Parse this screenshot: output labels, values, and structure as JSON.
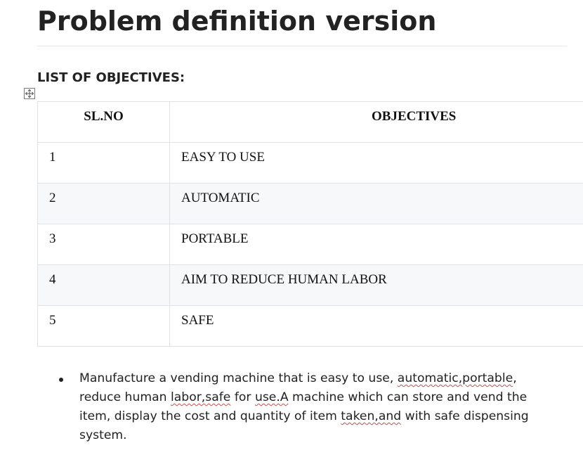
{
  "document": {
    "title": "Problem definition version",
    "section_heading": "LIST OF OBJECTIVES:"
  },
  "table": {
    "headers": [
      "SL.NO",
      "OBJECTIVES"
    ],
    "rows": [
      {
        "sl": "1",
        "objective": "EASY TO USE"
      },
      {
        "sl": "2",
        "objective": "AUTOMATIC"
      },
      {
        "sl": "3",
        "objective": "PORTABLE"
      },
      {
        "sl": "4",
        "objective": "AIM TO REDUCE HUMAN LABOR"
      },
      {
        "sl": "5",
        "objective": "SAFE"
      }
    ]
  },
  "bullets": [
    {
      "segments": [
        {
          "text": "Manufacture a vending machine that is easy to use, ",
          "misspelled": false
        },
        {
          "text": "automatic,portable",
          "misspelled": true
        },
        {
          "text": ", reduce human ",
          "misspelled": false
        },
        {
          "text": "labor,safe",
          "misspelled": true
        },
        {
          "text": " for ",
          "misspelled": false
        },
        {
          "text": "use.A",
          "misspelled": true
        },
        {
          "text": " machine which can store and vend the item, display the cost and quantity of item ",
          "misspelled": false
        },
        {
          "text": "taken,and",
          "misspelled": true
        },
        {
          "text": " with safe dispensing system.",
          "misspelled": false
        }
      ]
    }
  ],
  "icons": {
    "table_handle": "move-icon"
  },
  "colors": {
    "alt_row": "#f6f8fa",
    "border": "#dfe2e5",
    "spell_underline": "#c0504d"
  }
}
